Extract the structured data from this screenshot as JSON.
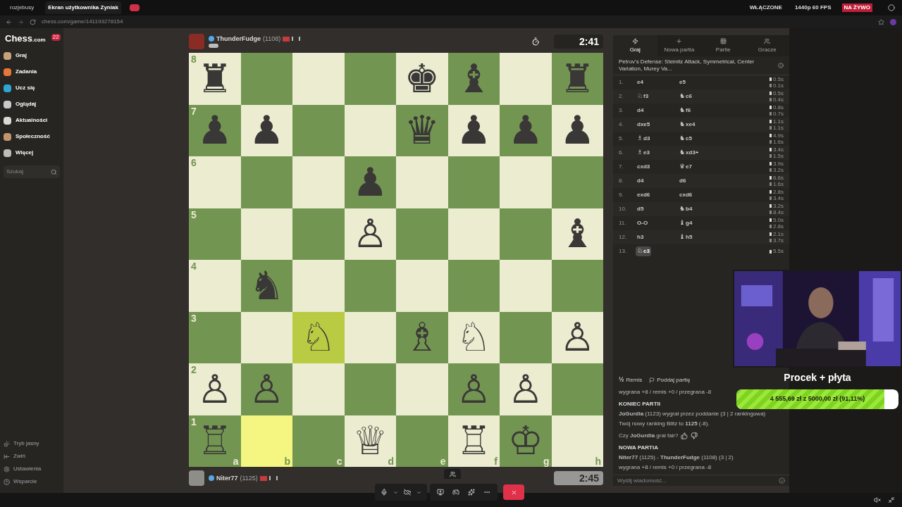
{
  "browser": {
    "tabs": [
      {
        "label": "rozjebusy",
        "selected": false
      },
      {
        "label": "Ekran użytkownika Zyniak",
        "selected": true
      }
    ],
    "status": [
      {
        "kind": "plain",
        "label": "WŁĄCZONE"
      },
      {
        "kind": "plain",
        "label": "1440p 60 FPS"
      },
      {
        "kind": "live",
        "label": "NA ŻYWO"
      }
    ],
    "address": "chess.com/game/141193278154"
  },
  "sidebar": {
    "logo": "Chess",
    "logo_suffix": ".com",
    "badge": "22",
    "items": [
      {
        "label": "Graj",
        "color": "#c8a27a"
      },
      {
        "label": "Zadania",
        "color": "#e8773a"
      },
      {
        "label": "Ucz się",
        "color": "#2fa6d1"
      },
      {
        "label": "Oglądaj",
        "color": "#c9c9c9"
      },
      {
        "label": "Aktualności",
        "color": "#d9d9d9"
      },
      {
        "label": "Społeczność",
        "color": "#c4956a"
      },
      {
        "label": "Więcej",
        "color": "#bdbdbd"
      }
    ],
    "search": {
      "placeholder": "Szukaj"
    },
    "footer": [
      "Tryb jasny",
      "Zwiń",
      "Ustawienia",
      "Wsparcie"
    ]
  },
  "top_player": {
    "name": "ThunderFudge",
    "rating": "(1108)",
    "clock": "2:41",
    "active": true
  },
  "bottom_player": {
    "name": "Niter77",
    "rating": "(1125)",
    "clock": "2:45",
    "active": false
  },
  "board": {
    "files": [
      "a",
      "b",
      "c",
      "d",
      "e",
      "f",
      "g",
      "h"
    ],
    "ranks": [
      {
        "label": "8",
        "squares": [
          {
            "piece": "♜",
            "highlighted": false
          },
          {
            "highlighted": false
          },
          {
            "highlighted": false
          },
          {
            "highlighted": false
          },
          {
            "piece": "♚",
            "highlighted": false
          },
          {
            "piece": "♝",
            "highlighted": false
          },
          {
            "highlighted": false
          },
          {
            "piece": "♜",
            "highlighted": false
          }
        ]
      },
      {
        "label": "7",
        "squares": [
          {
            "piece": "♟",
            "highlighted": false
          },
          {
            "piece": "♟",
            "highlighted": false
          },
          {
            "highlighted": false
          },
          {
            "highlighted": false
          },
          {
            "piece": "♛",
            "highlighted": false
          },
          {
            "piece": "♟",
            "highlighted": false
          },
          {
            "piece": "♟",
            "highlighted": false
          },
          {
            "piece": "♟",
            "highlighted": false
          }
        ]
      },
      {
        "label": "6",
        "squares": [
          {
            "highlighted": false
          },
          {
            "highlighted": false
          },
          {
            "highlighted": false
          },
          {
            "piece": "♟",
            "highlighted": false
          },
          {
            "highlighted": false
          },
          {
            "highlighted": false
          },
          {
            "highlighted": false
          },
          {
            "highlighted": false
          }
        ]
      },
      {
        "label": "5",
        "squares": [
          {
            "highlighted": false
          },
          {
            "highlighted": false
          },
          {
            "highlighted": false
          },
          {
            "piece": "♙",
            "highlighted": false
          },
          {
            "highlighted": false
          },
          {
            "highlighted": false
          },
          {
            "highlighted": false
          },
          {
            "piece": "♝",
            "highlighted": false
          }
        ]
      },
      {
        "label": "4",
        "squares": [
          {
            "highlighted": false
          },
          {
            "piece": "♞",
            "highlighted": false
          },
          {
            "highlighted": false
          },
          {
            "highlighted": false
          },
          {
            "highlighted": false
          },
          {
            "highlighted": false
          },
          {
            "highlighted": false
          },
          {
            "highlighted": false
          }
        ]
      },
      {
        "label": "3",
        "squares": [
          {
            "highlighted": false
          },
          {
            "highlighted": false
          },
          {
            "piece": "♘",
            "highlighted": true
          },
          {
            "highlighted": false
          },
          {
            "piece": "♗",
            "highlighted": false
          },
          {
            "piece": "♘",
            "highlighted": false
          },
          {
            "highlighted": false
          },
          {
            "piece": "♙",
            "highlighted": false
          }
        ]
      },
      {
        "label": "2",
        "squares": [
          {
            "piece": "♙",
            "highlighted": false
          },
          {
            "piece": "♙",
            "highlighted": false
          },
          {
            "highlighted": false
          },
          {
            "highlighted": false
          },
          {
            "highlighted": false
          },
          {
            "piece": "♙",
            "highlighted": false
          },
          {
            "piece": "♙",
            "highlighted": false
          },
          {
            "highlighted": false
          }
        ]
      },
      {
        "label": "1",
        "squares": [
          {
            "piece": "♖",
            "highlighted": false
          },
          {
            "highlighted": true
          },
          {
            "highlighted": false
          },
          {
            "piece": "♕",
            "highlighted": false
          },
          {
            "highlighted": false
          },
          {
            "piece": "♖",
            "highlighted": false
          },
          {
            "piece": "♔",
            "highlighted": false
          },
          {
            "highlighted": false
          }
        ]
      }
    ]
  },
  "panel": {
    "tabs": [
      {
        "label": "Graj",
        "selected": true
      },
      {
        "label": "Nowa partia",
        "selected": false
      },
      {
        "label": "Partie",
        "selected": false
      },
      {
        "label": "Gracze",
        "selected": false
      }
    ],
    "opening": "Petrov's Defense: Steinitz Attack, Symmetrical, Center Variation, Murey Va...",
    "moves": [
      {
        "number": "1.",
        "white": {
          "san": "e4",
          "selected": false
        },
        "black": {
          "san": "e5",
          "selected": false
        },
        "times": [
          "0.5s",
          "0.1s"
        ]
      },
      {
        "number": "2.",
        "white": {
          "piece": "♘",
          "san": "f3",
          "selected": false
        },
        "black": {
          "piece": "♞",
          "san": "c6",
          "selected": false
        },
        "times": [
          "0.5s",
          "0.4s"
        ]
      },
      {
        "number": "3.",
        "white": {
          "san": "d4",
          "selected": false
        },
        "black": {
          "piece": "♞",
          "san": "f6",
          "selected": false
        },
        "times": [
          "0.8s",
          "0.7s"
        ]
      },
      {
        "number": "4.",
        "white": {
          "san": "dxe5",
          "selected": false
        },
        "black": {
          "piece": "♞",
          "san": "xe4",
          "selected": false
        },
        "times": [
          "1.1s",
          "1.1s"
        ]
      },
      {
        "number": "5.",
        "white": {
          "piece": "♗",
          "san": "d3",
          "selected": false
        },
        "black": {
          "piece": "♞",
          "san": "c5",
          "selected": false
        },
        "times": [
          "4.9s",
          "1.6s"
        ]
      },
      {
        "number": "6.",
        "white": {
          "piece": "♗",
          "san": "e3",
          "selected": false
        },
        "black": {
          "piece": "♞",
          "san": "xd3+",
          "selected": false
        },
        "times": [
          "3.4s",
          "1.5s"
        ]
      },
      {
        "number": "7.",
        "white": {
          "san": "cxd3",
          "selected": false
        },
        "black": {
          "piece": "♛",
          "san": "e7",
          "selected": false
        },
        "times": [
          "3.9s",
          "3.2s"
        ]
      },
      {
        "number": "8.",
        "white": {
          "san": "d4",
          "selected": false
        },
        "black": {
          "san": "d6",
          "selected": false
        },
        "times": [
          "6.6s",
          "1.6s"
        ]
      },
      {
        "number": "9.",
        "white": {
          "san": "exd6",
          "selected": false
        },
        "black": {
          "san": "cxd6",
          "selected": false
        },
        "times": [
          "2.8s",
          "3.4s"
        ]
      },
      {
        "number": "10.",
        "white": {
          "san": "d5",
          "selected": false
        },
        "black": {
          "piece": "♞",
          "san": "b4",
          "selected": false
        },
        "times": [
          "3.2s",
          "8.4s"
        ]
      },
      {
        "number": "11.",
        "white": {
          "san": "O-O",
          "selected": false
        },
        "black": {
          "piece": "♝",
          "san": "g4",
          "selected": false
        },
        "times": [
          "5.0s",
          "2.8s"
        ]
      },
      {
        "number": "12.",
        "white": {
          "san": "h3",
          "selected": false
        },
        "black": {
          "piece": "♝",
          "san": "h5",
          "selected": false
        },
        "times": [
          "2.1s",
          "3.7s"
        ]
      },
      {
        "number": "13.",
        "white": {
          "piece": "♘",
          "san": "c3",
          "selected": true
        },
        "times": [
          "5.5s"
        ]
      }
    ],
    "actions": [
      {
        "icon": "½",
        "label": "Remis"
      },
      {
        "label": "Poddaj partię"
      }
    ],
    "chat": [
      {
        "kind": "line",
        "text": "wygrana +8 / remis +0 / przegrana -8"
      },
      {
        "kind": "heading",
        "text": "KONIEC PARTII"
      },
      {
        "kind": "line",
        "text": "**JoGurdia** (1123) wygrał przez poddanie (3 | 2 rankingowa)"
      },
      {
        "kind": "line",
        "text": "Twój nowy ranking Blitz to **1125** (-8)."
      },
      {
        "kind": "fair",
        "text": "Czy **JoGurdia** grał fair?"
      },
      {
        "kind": "heading",
        "text": "NOWA PARTIA"
      },
      {
        "kind": "line",
        "text": "**Niter77** (1125) - **ThunderFudge** (1108) (3 | 2)"
      },
      {
        "kind": "line",
        "text": "wygrana +8 / remis +0 / przegrana -8"
      }
    ],
    "message": {
      "placeholder": "Wyślij wiadomość..."
    }
  },
  "overlay": {
    "title": "Procek + płyta",
    "goal": {
      "text": "4 555,69 zł z 5000,00 zł (91,11%)",
      "level": 0.9111
    }
  }
}
